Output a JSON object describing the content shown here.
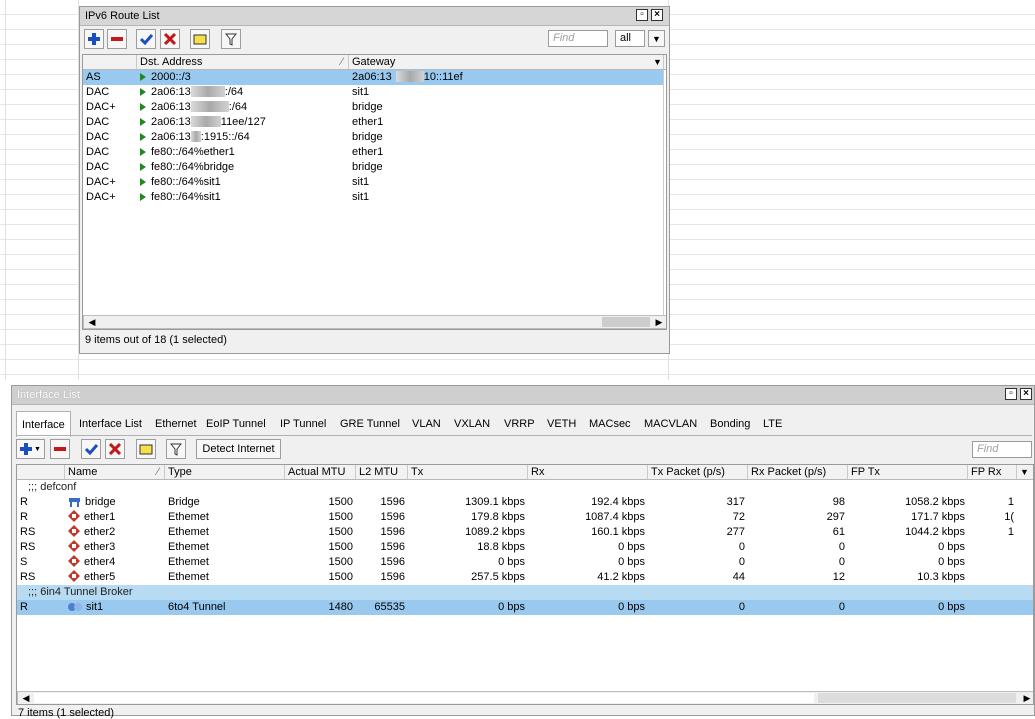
{
  "route_window": {
    "title": "IPv6 Route List",
    "find_placeholder": "Find",
    "filter_value": "all",
    "columns": {
      "flags": "",
      "dst": "Dst. Address",
      "gateway": "Gateway"
    },
    "rows": [
      {
        "flag": "AS",
        "dst": "2000::/3",
        "gateway_pre": "2a06:13",
        "gateway_post": "10::11ef",
        "selected": true
      },
      {
        "flag": "DAC",
        "dst_pre": "2a06:13",
        "dst_post": ":/64",
        "gateway": "sit1"
      },
      {
        "flag": "DAC+",
        "dst_pre": "2a06:13",
        "dst_post": ":/64",
        "gateway": "bridge"
      },
      {
        "flag": "DAC",
        "dst_pre": "2a06:13",
        "dst_post": "11ee/127",
        "gateway": "ether1"
      },
      {
        "flag": "DAC",
        "dst_pre": "2a06:13",
        "dst_post": ":1915::/64",
        "gateway": "bridge"
      },
      {
        "flag": "DAC",
        "dst": "fe80::/64%ether1",
        "gateway": "ether1"
      },
      {
        "flag": "DAC",
        "dst": "fe80::/64%bridge",
        "gateway": "bridge"
      },
      {
        "flag": "DAC+",
        "dst": "fe80::/64%sit1",
        "gateway": "sit1"
      },
      {
        "flag": "DAC+",
        "dst": "fe80::/64%sit1",
        "gateway": "sit1"
      }
    ],
    "status": "9 items out of 18 (1 selected)"
  },
  "interface_window": {
    "title": "Interface List",
    "tabs": [
      "Interface",
      "Interface List",
      "Ethernet",
      "EoIP Tunnel",
      "IP Tunnel",
      "GRE Tunnel",
      "VLAN",
      "VXLAN",
      "VRRP",
      "VETH",
      "MACsec",
      "MACVLAN",
      "Bonding",
      "LTE"
    ],
    "detect_label": "Detect Internet",
    "find_placeholder": "Find",
    "columns": [
      "",
      "Name",
      "Type",
      "Actual MTU",
      "L2 MTU",
      "Tx",
      "Rx",
      "Tx Packet (p/s)",
      "Rx Packet (p/s)",
      "FP Tx",
      "FP Rx"
    ],
    "group1": ";;; defconf",
    "group2": ";;; 6in4 Tunnel Broker",
    "rows": [
      {
        "flag": "R",
        "name": "bridge",
        "icon": "bridge-icon",
        "type": "Bridge",
        "mtu": "1500",
        "l2mtu": "1596",
        "tx": "1309.1 kbps",
        "rx": "192.4 kbps",
        "txp": "317",
        "rxp": "98",
        "fptx": "1058.2 kbps",
        "fprx": "1"
      },
      {
        "flag": "R",
        "name": "ether1",
        "icon": "ethernet-icon",
        "type": "Ethemet",
        "mtu": "1500",
        "l2mtu": "1596",
        "tx": "179.8 kbps",
        "rx": "1087.4 kbps",
        "txp": "72",
        "rxp": "297",
        "fptx": "171.7 kbps",
        "fprx": "1("
      },
      {
        "flag": "RS",
        "name": "ether2",
        "icon": "ethernet-icon",
        "type": "Ethemet",
        "mtu": "1500",
        "l2mtu": "1596",
        "tx": "1089.2 kbps",
        "rx": "160.1 kbps",
        "txp": "277",
        "rxp": "61",
        "fptx": "1044.2 kbps",
        "fprx": "1"
      },
      {
        "flag": "RS",
        "name": "ether3",
        "icon": "ethernet-icon",
        "type": "Ethemet",
        "mtu": "1500",
        "l2mtu": "1596",
        "tx": "18.8 kbps",
        "rx": "0 bps",
        "txp": "0",
        "rxp": "0",
        "fptx": "0 bps",
        "fprx": ""
      },
      {
        "flag": "S",
        "name": "ether4",
        "icon": "ethernet-icon",
        "type": "Ethemet",
        "mtu": "1500",
        "l2mtu": "1596",
        "tx": "0 bps",
        "rx": "0 bps",
        "txp": "0",
        "rxp": "0",
        "fptx": "0 bps",
        "fprx": ""
      },
      {
        "flag": "RS",
        "name": "ether5",
        "icon": "ethernet-icon",
        "type": "Ethemet",
        "mtu": "1500",
        "l2mtu": "1596",
        "tx": "257.5 kbps",
        "rx": "41.2 kbps",
        "txp": "44",
        "rxp": "12",
        "fptx": "10.3 kbps",
        "fprx": ""
      }
    ],
    "tunnel_row": {
      "flag": "R",
      "name": "sit1",
      "icon": "tunnel-icon",
      "type": "6to4 Tunnel",
      "mtu": "1480",
      "l2mtu": "65535",
      "tx": "0 bps",
      "rx": "0 bps",
      "txp": "0",
      "rxp": "0",
      "fptx": "0 bps",
      "fprx": ""
    },
    "status": "7 items (1 selected)"
  },
  "colors": {
    "selected": "#99c9ef",
    "group": "#b7dbf3",
    "add": "#1b4fbf",
    "remove": "#c21818",
    "enable": "#1b4fbf",
    "disable": "#c21818"
  }
}
